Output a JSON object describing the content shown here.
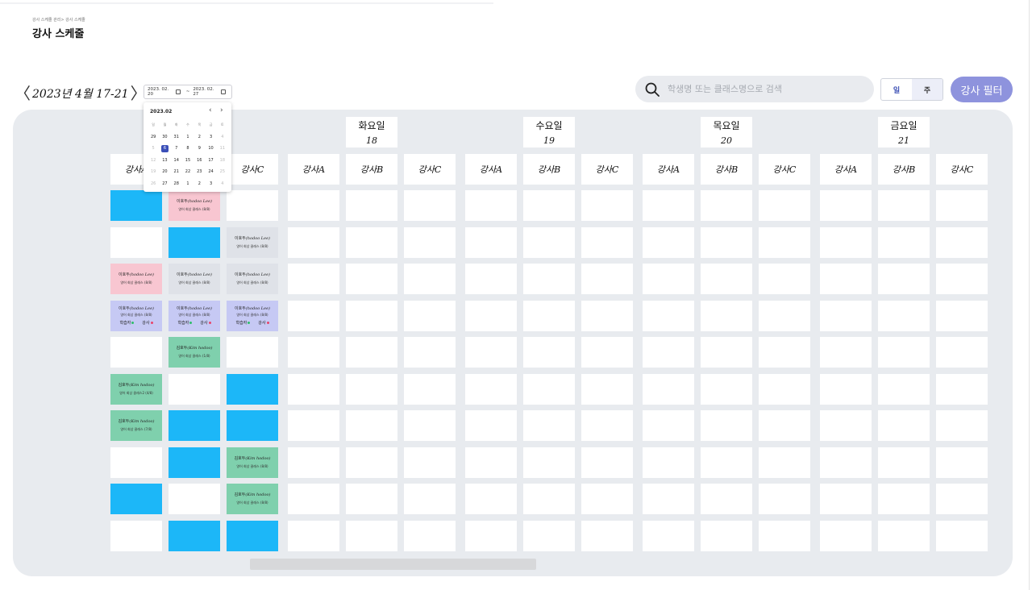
{
  "header": {
    "breadcrumb": "강사 스케줄 관리> 강사 스케줄",
    "title": "강사 스케줄"
  },
  "week": {
    "title": "2023년 4월 17-21",
    "range_start": "2023. 02. 20",
    "range_end": "2023. 02. 27",
    "range_sep": "~"
  },
  "search": {
    "placeholder": "학생명 또는 클래스명으로 검색"
  },
  "view_toggle": {
    "day": "일",
    "week": "주"
  },
  "filter_button": "강사 필터",
  "days": [
    {
      "name": "화요일",
      "date": "18"
    },
    {
      "name": "수요일",
      "date": "19"
    },
    {
      "name": "목요일",
      "date": "20"
    },
    {
      "name": "금요일",
      "date": "21"
    }
  ],
  "columns": [
    "강사A",
    "강사B",
    "강사C",
    "강사A",
    "강사B",
    "강사C",
    "강사A",
    "강사B",
    "강사C",
    "강사A",
    "강사B",
    "강사C",
    "강사A",
    "강사B",
    "강사C"
  ],
  "schedule": [
    [
      {
        "color": "blue"
      },
      {
        "color": "pink",
        "name": "이호두",
        "en": "(hodoo Lee)",
        "cls": "영어 회상 클래스 (8/8)"
      },
      {
        "color": "white"
      }
    ],
    [
      {
        "color": "white"
      },
      {
        "color": "blue"
      },
      {
        "color": "gray",
        "name": "이호두",
        "en": "(hodoo Lee)",
        "cls": "영어 회상 클래스 (8/8)"
      }
    ],
    [
      {
        "color": "pink",
        "name": "이호두",
        "en": "(hodoo Lee)",
        "cls": "영어 회상 클래스 (8/8)"
      },
      {
        "color": "gray",
        "name": "이호두",
        "en": "(hodoo Lee)",
        "cls": "영어 회상 클래스 (8/8)"
      },
      {
        "color": "gray",
        "name": "이호두",
        "en": "(hodoo Lee)",
        "cls": "영어 회상 클래스 (8/8)"
      }
    ],
    [
      {
        "color": "lav",
        "name": "이호두",
        "en": "(hodoo Lee)",
        "cls": "영어 회상 클래스 (8/8)",
        "tags": [
          "학습자",
          "강사"
        ]
      },
      {
        "color": "lav",
        "name": "이호두",
        "en": "(hodoo Lee)",
        "cls": "영어 회상 클래스 (8/8)",
        "tags": [
          "학습자",
          "강사"
        ]
      },
      {
        "color": "lav",
        "name": "이호두",
        "en": "(hodoo Lee)",
        "cls": "영어 회상 클래스 (8/8)",
        "tags": [
          "학습자",
          "강사"
        ]
      }
    ],
    [
      {
        "color": "white"
      },
      {
        "color": "green",
        "name": "김호두",
        "en": "(Kim hodoo)",
        "cls": "영어 회상 클래스 (1/8)"
      },
      {
        "color": "white"
      }
    ],
    [
      {
        "color": "green",
        "name": "김호두",
        "en": "(Kim hodoo)",
        "cls": "영어 회상 클래스2 (4/8)"
      },
      {
        "color": "white"
      },
      {
        "color": "blue"
      }
    ],
    [
      {
        "color": "green",
        "name": "김호두",
        "en": "(Kim hodoo)",
        "cls": "영어 회상 클래스 (7/8)"
      },
      {
        "color": "blue"
      },
      {
        "color": "blue"
      }
    ],
    [
      {
        "color": "white"
      },
      {
        "color": "blue"
      },
      {
        "color": "green",
        "name": "김호두",
        "en": "(Kim hodoo)",
        "cls": "영어 회상 클래스 (8/8)"
      }
    ],
    [
      {
        "color": "blue"
      },
      {
        "color": "white"
      },
      {
        "color": "green",
        "name": "김호두",
        "en": "(Kim hodoo)",
        "cls": "영어 회상 클래스 (8/8)"
      }
    ],
    [
      {
        "color": "white"
      },
      {
        "color": "blue"
      },
      {
        "color": "blue"
      }
    ]
  ],
  "colors": {
    "blue": "#1cb7f8",
    "pink": "#f8c6d1",
    "gray": "#dfe2e8",
    "lav": "#c6c9f4",
    "green": "#7fd0ad",
    "accent": "#8e93dd"
  },
  "datepicker": {
    "month": "2023.02",
    "weekdays": [
      "일",
      "월",
      "화",
      "수",
      "목",
      "금",
      "토"
    ],
    "weeks": [
      [
        {
          "d": "29"
        },
        {
          "d": "30"
        },
        {
          "d": "31"
        },
        {
          "d": "1"
        },
        {
          "d": "2"
        },
        {
          "d": "3"
        },
        {
          "d": "4",
          "m": true
        }
      ],
      [
        {
          "d": "5",
          "m": true
        },
        {
          "d": "6",
          "sel": true
        },
        {
          "d": "7"
        },
        {
          "d": "8"
        },
        {
          "d": "9"
        },
        {
          "d": "10"
        },
        {
          "d": "11",
          "m": true
        }
      ],
      [
        {
          "d": "12",
          "m": true
        },
        {
          "d": "13"
        },
        {
          "d": "14"
        },
        {
          "d": "15"
        },
        {
          "d": "16"
        },
        {
          "d": "17"
        },
        {
          "d": "18",
          "m": true
        }
      ],
      [
        {
          "d": "19",
          "m": true
        },
        {
          "d": "20"
        },
        {
          "d": "21"
        },
        {
          "d": "22"
        },
        {
          "d": "23"
        },
        {
          "d": "24"
        },
        {
          "d": "25",
          "m": true
        }
      ],
      [
        {
          "d": "26",
          "m": true
        },
        {
          "d": "27"
        },
        {
          "d": "28"
        },
        {
          "d": "1"
        },
        {
          "d": "2"
        },
        {
          "d": "3"
        },
        {
          "d": "4",
          "m": true
        }
      ]
    ]
  }
}
